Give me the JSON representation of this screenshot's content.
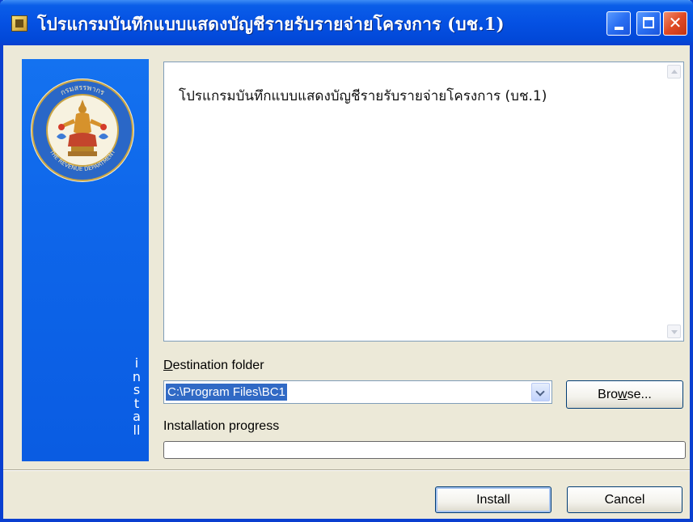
{
  "window": {
    "title": "โปรแกรมบันทึกแบบแสดงบัญชีรายรับรายจ่ายโครงการ (บช.1)"
  },
  "banner": {
    "text": "install",
    "logo_ring_top": "กรมสรรพากร",
    "logo_ring_bottom": "THE REVENUE DEPARTMENT",
    "color": "#0e66ea"
  },
  "content": {
    "text": "โปรแกรมบันทึกแบบแสดงบัญชีรายรับรายจ่ายโครงการ (บช.1)"
  },
  "destination": {
    "label_prefix": "",
    "label_access": "D",
    "label_rest": "estination folder",
    "value": "C:\\Program Files\\BC1"
  },
  "browse": {
    "label_pre": "Bro",
    "label_access": "w",
    "label_post": "se..."
  },
  "progress": {
    "label": "Installation progress",
    "value": 0
  },
  "footer": {
    "install_label": "Install",
    "cancel_label": "Cancel"
  },
  "icons": {
    "app": "app-icon",
    "minimize": "minimize-icon",
    "maximize": "maximize-icon",
    "close": "close-icon"
  }
}
